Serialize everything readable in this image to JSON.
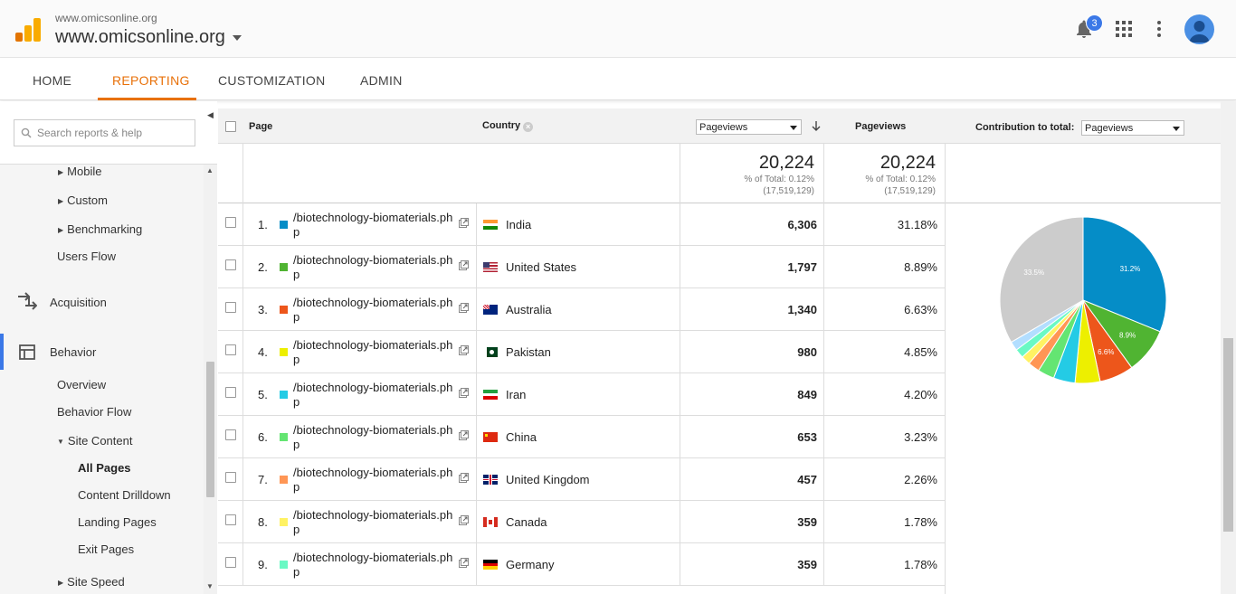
{
  "header": {
    "site_small": "www.omicsonline.org",
    "site_big": "www.omicsonline.org",
    "notification_count": "3"
  },
  "nav": {
    "tabs": [
      {
        "label": "HOME"
      },
      {
        "label": "REPORTING",
        "active": true
      },
      {
        "label": "CUSTOMIZATION"
      },
      {
        "label": "ADMIN"
      }
    ]
  },
  "sidebar": {
    "search_placeholder": "Search reports & help",
    "items": {
      "mobile": "Mobile",
      "custom": "Custom",
      "benchmarking": "Benchmarking",
      "users_flow": "Users Flow",
      "acquisition": "Acquisition",
      "behavior": "Behavior",
      "overview": "Overview",
      "behavior_flow": "Behavior Flow",
      "site_content": "Site Content",
      "all_pages": "All Pages",
      "content_drilldown": "Content Drilldown",
      "landing_pages": "Landing Pages",
      "exit_pages": "Exit Pages",
      "site_speed": "Site Speed"
    }
  },
  "table": {
    "col_page": "Page",
    "col_country": "Country",
    "metric_select": "Pageviews",
    "col_pageviews": "Pageviews",
    "contribution_label": "Contribution to total:",
    "contribution_select": "Pageviews",
    "totals": {
      "value_a": "20,224",
      "pct_a": "% of Total: 0.12%",
      "base_a": "(17,519,129)",
      "value_b": "20,224",
      "pct_b": "% of Total: 0.12%",
      "base_b": "(17,519,129)"
    },
    "rows": [
      {
        "num": "1.",
        "page": "/biotechnology-biomaterials.php",
        "country": "India",
        "pageviews": "6,306",
        "pct": "31.18%",
        "color": "#058dc7"
      },
      {
        "num": "2.",
        "page": "/biotechnology-biomaterials.php",
        "country": "United States",
        "pageviews": "1,797",
        "pct": "8.89%",
        "color": "#50b432"
      },
      {
        "num": "3.",
        "page": "/biotechnology-biomaterials.php",
        "country": "Australia",
        "pageviews": "1,340",
        "pct": "6.63%",
        "color": "#ed561b"
      },
      {
        "num": "4.",
        "page": "/biotechnology-biomaterials.php",
        "country": "Pakistan",
        "pageviews": "980",
        "pct": "4.85%",
        "color": "#edef00"
      },
      {
        "num": "5.",
        "page": "/biotechnology-biomaterials.php",
        "country": "Iran",
        "pageviews": "849",
        "pct": "4.20%",
        "color": "#24cbe5"
      },
      {
        "num": "6.",
        "page": "/biotechnology-biomaterials.php",
        "country": "China",
        "pageviews": "653",
        "pct": "3.23%",
        "color": "#64e572"
      },
      {
        "num": "7.",
        "page": "/biotechnology-biomaterials.php",
        "country": "United Kingdom",
        "pageviews": "457",
        "pct": "2.26%",
        "color": "#ff9655"
      },
      {
        "num": "8.",
        "page": "/biotechnology-biomaterials.php",
        "country": "Canada",
        "pageviews": "359",
        "pct": "1.78%",
        "color": "#fff263"
      },
      {
        "num": "9.",
        "page": "/biotechnology-biomaterials.php",
        "country": "Germany",
        "pageviews": "359",
        "pct": "1.78%",
        "color": "#6af9c4"
      }
    ]
  },
  "chart_data": {
    "type": "pie",
    "values": [
      31.18,
      8.89,
      6.63,
      4.85,
      4.2,
      3.23,
      2.26,
      1.78,
      1.78,
      1.78,
      33.42
    ],
    "colors": [
      "#058dc7",
      "#50b432",
      "#ed561b",
      "#edef00",
      "#24cbe5",
      "#64e572",
      "#ff9655",
      "#fff263",
      "#6af9c4",
      "#b2deff",
      "#cccccc"
    ],
    "slice_labels": [
      "31.2%",
      "8.9%",
      "6.6%",
      "",
      "",
      "",
      "",
      "",
      "",
      "",
      "33.5%"
    ]
  }
}
